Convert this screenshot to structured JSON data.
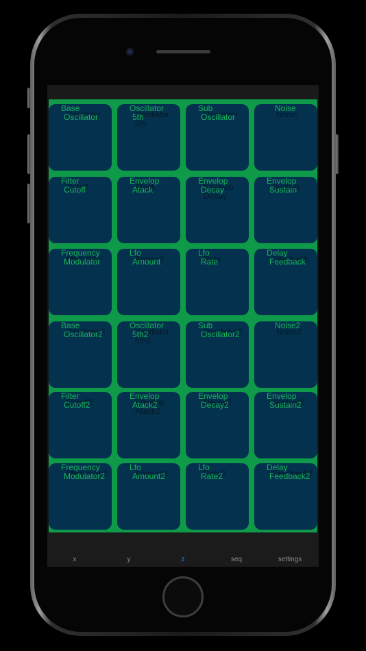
{
  "pads": [
    {
      "id": "base-oscillator",
      "line1": "Base",
      "line2": "Oscillator",
      "shadow1": "",
      "shadow2": "Oscillator"
    },
    {
      "id": "oscillator-5th",
      "line1": "Oscillator",
      "line2": "5th",
      "shadow1": "Oscillator",
      "shadow2": "5th"
    },
    {
      "id": "sub-oscillator",
      "line1": "Sub",
      "line2": "Oscillator",
      "shadow1": "",
      "shadow2": "Oscillator"
    },
    {
      "id": "noise",
      "line1": "Noise",
      "line2": "",
      "shadow1": "Noise",
      "shadow2": ""
    },
    {
      "id": "filter-cutoff",
      "line1": "Filter",
      "line2": "Cutoff",
      "shadow1": "",
      "shadow2": "Cutoff"
    },
    {
      "id": "envelop-atack",
      "line1": "Envelop",
      "line2": "Atack",
      "shadow1": "",
      "shadow2": "Atack"
    },
    {
      "id": "envelop-decay",
      "line1": "Envelop",
      "line2": "Decay",
      "shadow1": "Envelop",
      "shadow2": "Decay"
    },
    {
      "id": "envelop-sustain",
      "line1": "Envelop",
      "line2": "Sustain",
      "shadow1": "",
      "shadow2": "Sustain"
    },
    {
      "id": "frequency-modulator",
      "line1": "Frequency",
      "line2": "Modulator",
      "shadow1": "",
      "shadow2": "Modulator"
    },
    {
      "id": "lfo-amount",
      "line1": "Lfo",
      "line2": "Amount",
      "shadow1": "",
      "shadow2": "Amount"
    },
    {
      "id": "lfo-rate",
      "line1": "Lfo",
      "line2": "Rate",
      "shadow1": "",
      "shadow2": "Rate"
    },
    {
      "id": "delay-feedback",
      "line1": "Delay",
      "line2": "Feedback",
      "shadow1": "",
      "shadow2": "Feedback"
    },
    {
      "id": "base-oscillator2",
      "line1": "Base",
      "line2": "Oscillator2",
      "shadow1": "",
      "shadow2": "Oscillator2"
    },
    {
      "id": "oscillator-5th2",
      "line1": "Oscillator",
      "line2": "5th2",
      "shadow1": "Oscillator",
      "shadow2": "5th2"
    },
    {
      "id": "sub-oscillator2",
      "line1": "Sub",
      "line2": "Oscillator2",
      "shadow1": "",
      "shadow2": "Oscillator2"
    },
    {
      "id": "noise2",
      "line1": "Noise2",
      "line2": "",
      "shadow1": "Noise2",
      "shadow2": ""
    },
    {
      "id": "filter-cutoff2",
      "line1": "Filter",
      "line2": "Cutoff2",
      "shadow1": "",
      "shadow2": "Cutoff2"
    },
    {
      "id": "envelop-atack2",
      "line1": "Envelop",
      "line2": "Atack2",
      "shadow1": "Envelop",
      "shadow2": "Atack2"
    },
    {
      "id": "envelop-decay2",
      "line1": "Envelop",
      "line2": "Decay2",
      "shadow1": "",
      "shadow2": "Decay2"
    },
    {
      "id": "envelop-sustain2",
      "line1": "Envelop",
      "line2": "Sustain2",
      "shadow1": "",
      "shadow2": "Sustain2"
    },
    {
      "id": "frequency-modulator2",
      "line1": "Frequency",
      "line2": "Modulator2",
      "shadow1": "",
      "shadow2": "Modulator2"
    },
    {
      "id": "lfo-amount2",
      "line1": "Lfo",
      "line2": "Amount2",
      "shadow1": "",
      "shadow2": "Amount2"
    },
    {
      "id": "lfo-rate2",
      "line1": "Lfo",
      "line2": "Rate2",
      "shadow1": "",
      "shadow2": "Rate2"
    },
    {
      "id": "delay-feedback2",
      "line1": "Delay",
      "line2": "Feedback2",
      "shadow1": "",
      "shadow2": "Feedback2"
    }
  ],
  "tabs": [
    {
      "id": "x",
      "label": "x",
      "active": false
    },
    {
      "id": "y",
      "label": "y",
      "active": false
    },
    {
      "id": "z",
      "label": "z",
      "active": true
    },
    {
      "id": "seq",
      "label": "seq",
      "active": false
    },
    {
      "id": "settings",
      "label": "settings",
      "active": false
    }
  ],
  "colors": {
    "grid_background": "#0f9a4a",
    "pad_fill": "#04324e",
    "pad_label": "#18b45a",
    "tab_active": "#2f7fd8",
    "tab_inactive": "#8e8e93"
  }
}
